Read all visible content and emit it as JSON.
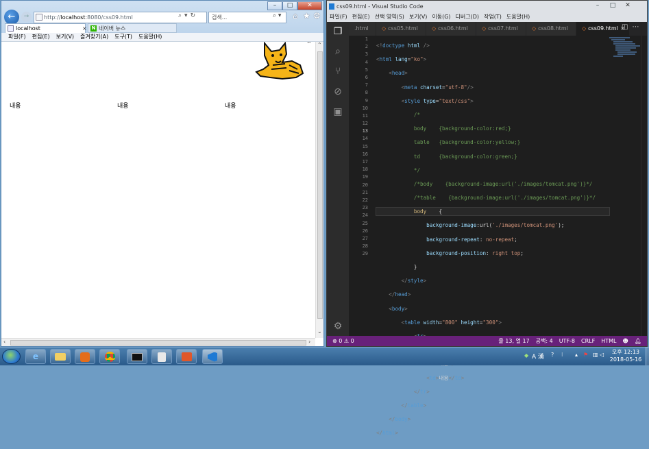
{
  "ie": {
    "address": {
      "prefix": "http://",
      "host": "localhost",
      "rest": ":8080/css09.html"
    },
    "search_placeholder": "검색...",
    "tabs": [
      {
        "label": "localhost",
        "close": "×"
      },
      {
        "label": "네이버 뉴스",
        "icon": "N"
      }
    ],
    "menu": [
      "파일(F)",
      "편집(E)",
      "보기(V)",
      "즐겨찾기(A)",
      "도구(T)",
      "도움말(H)"
    ],
    "cells": [
      "내용",
      "내용",
      "내용"
    ],
    "tm": "™",
    "window_buttons": [
      "–",
      "□",
      "✕"
    ]
  },
  "vscode": {
    "title": "css09.html - Visual Studio Code",
    "menu": [
      "파일(F)",
      "편집(E)",
      "선택 영역(S)",
      "보기(V)",
      "이동(G)",
      "디버그(D)",
      "작업(T)",
      "도움말(H)"
    ],
    "tabs": [
      ".html",
      "css05.html",
      "css06.html",
      "css07.html",
      "css08.html",
      "css09.html"
    ],
    "active_tab": "css09.html",
    "status": {
      "errors": "⊗ 0 ⚠ 0",
      "position": "줄 13, 열 17",
      "spaces": "공백: 4",
      "encoding": "UTF-8",
      "eol": "CRLF",
      "language": "HTML"
    }
  },
  "taskbar": {
    "tray_lang": "A 漢",
    "clock_time": "오후 12:13",
    "clock_date": "2018-05-16"
  },
  "colors": {
    "statusbar": "#68217a",
    "editor_bg": "#1e1e1e",
    "ie_accent": "#1b5aa8"
  }
}
